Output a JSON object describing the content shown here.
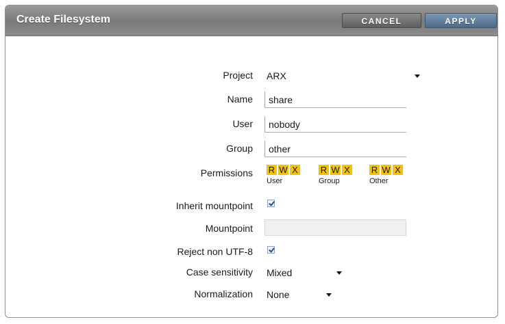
{
  "dialog": {
    "title": "Create Filesystem",
    "cancel_label": "CANCEL",
    "apply_label": "APPLY"
  },
  "form": {
    "project": {
      "label": "Project",
      "value": "ARX"
    },
    "name": {
      "label": "Name",
      "value": "share"
    },
    "user": {
      "label": "User",
      "value": "nobody"
    },
    "group": {
      "label": "Group",
      "value": "other"
    },
    "permissions": {
      "label": "Permissions",
      "groups": [
        {
          "caption": "User",
          "letters": [
            "R",
            "W",
            "X"
          ]
        },
        {
          "caption": "Group",
          "letters": [
            "R",
            "W",
            "X"
          ]
        },
        {
          "caption": "Other",
          "letters": [
            "R",
            "W",
            "X"
          ]
        }
      ]
    },
    "inherit_mountpoint": {
      "label": "Inherit mountpoint",
      "checked": true
    },
    "mountpoint": {
      "label": "Mountpoint",
      "value": ""
    },
    "reject_non_utf8": {
      "label": "Reject non UTF-8",
      "checked": true
    },
    "case_sensitivity": {
      "label": "Case sensitivity",
      "value": "Mixed"
    },
    "normalization": {
      "label": "Normalization",
      "value": "None"
    }
  },
  "colors": {
    "permission_badge": "#f4c20d",
    "apply_button": "#5b7896",
    "cancel_button": "#6e6e6e"
  }
}
